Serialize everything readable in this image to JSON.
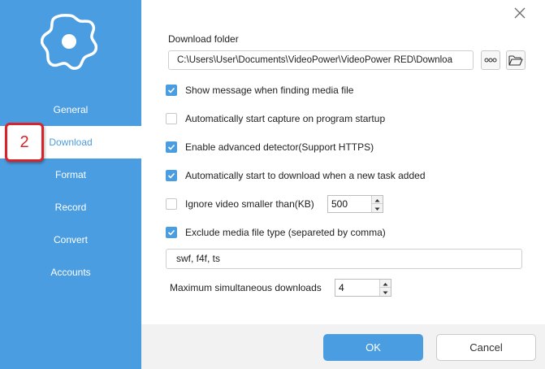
{
  "colors": {
    "accent": "#4a9de0",
    "badge": "#d8232a"
  },
  "sidebar": {
    "logo_icon": "gear-icon",
    "items": [
      {
        "label": "General"
      },
      {
        "label": "Download",
        "active": true
      },
      {
        "label": "Format"
      },
      {
        "label": "Record"
      },
      {
        "label": "Convert"
      },
      {
        "label": "Accounts"
      }
    ]
  },
  "callout": {
    "number": "2"
  },
  "download_folder": {
    "label": "Download folder",
    "value": "C:\\Users\\User\\Documents\\VideoPower\\VideoPower RED\\Downloa",
    "more_icon": "more-options-icon",
    "browse_icon": "folder-open-icon"
  },
  "options": [
    {
      "label": "Show message when finding media file",
      "checked": true
    },
    {
      "label": "Automatically start capture on program startup",
      "checked": false
    },
    {
      "label": "Enable advanced detector(Support HTTPS)",
      "checked": true
    },
    {
      "label": "Automatically start to download when a new task added",
      "checked": true
    },
    {
      "label": "Ignore video smaller than(KB)",
      "checked": false
    },
    {
      "label": "Exclude media file type (separeted by comma)",
      "checked": true
    }
  ],
  "ignore_size": {
    "value": "500"
  },
  "exclude_types": {
    "value": "swf, f4f, ts"
  },
  "max_downloads": {
    "label": "Maximum simultaneous downloads",
    "value": "4"
  },
  "footer": {
    "ok_label": "OK",
    "cancel_label": "Cancel"
  }
}
